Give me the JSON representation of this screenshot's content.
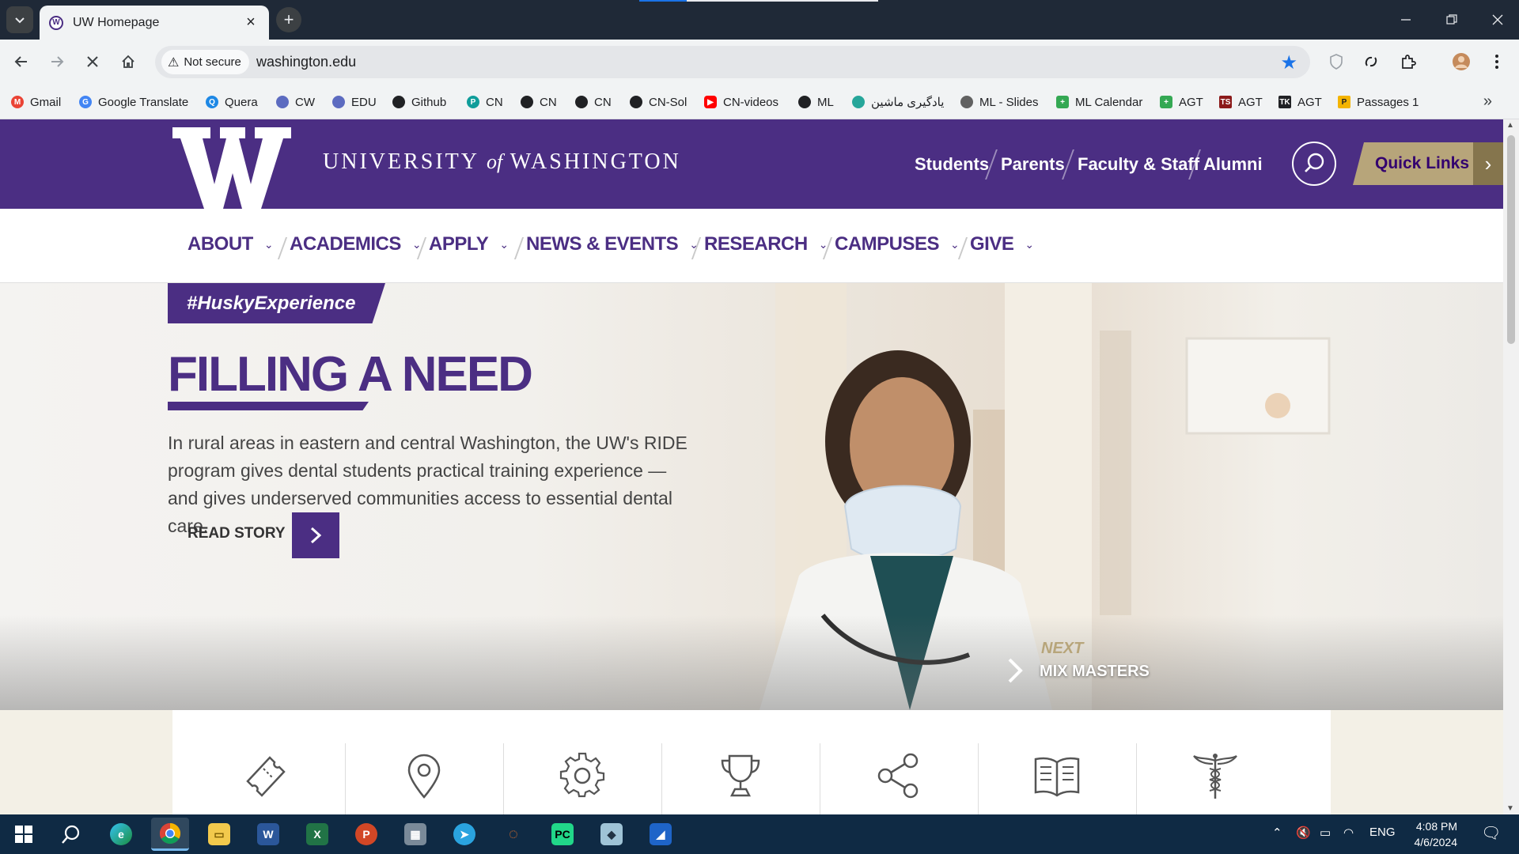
{
  "browser": {
    "tab_title": "UW Homepage",
    "security_label": "Not secure",
    "url": "washington.edu",
    "bookmarks": [
      {
        "label": "Gmail",
        "icon": "gmail-icon",
        "color": "#ea4335"
      },
      {
        "label": "Google Translate",
        "icon": "translate-icon",
        "color": "#4285f4"
      },
      {
        "label": "Quera",
        "icon": "quera-icon",
        "color": "#1e88e5"
      },
      {
        "label": "CW",
        "icon": "globe-icon",
        "color": "#5c6bc0"
      },
      {
        "label": "EDU",
        "icon": "globe-icon",
        "color": "#5c6bc0"
      },
      {
        "label": "Github",
        "icon": "github-icon",
        "color": "#202124"
      },
      {
        "label": "CN",
        "icon": "p-icon",
        "color": "#0f9d9a"
      },
      {
        "label": "CN",
        "icon": "globe-dark-icon",
        "color": "#202124"
      },
      {
        "label": "CN",
        "icon": "globe-dark-icon",
        "color": "#202124"
      },
      {
        "label": "CN-Sol",
        "icon": "github-icon",
        "color": "#202124"
      },
      {
        "label": "CN-videos",
        "icon": "youtube-icon",
        "color": "#ff0000"
      },
      {
        "label": "ML",
        "icon": "globe-dark-icon",
        "color": "#202124"
      },
      {
        "label": "یادگیری ماشین",
        "icon": "ml-icon",
        "color": "#26a69a"
      },
      {
        "label": "ML - Slides",
        "icon": "pen-icon",
        "color": "#616161"
      },
      {
        "label": "ML Calendar",
        "icon": "plus-icon",
        "color": "#34a853"
      },
      {
        "label": "AGT",
        "icon": "plus-icon",
        "color": "#34a853"
      },
      {
        "label": "AGT",
        "icon": "ts-icon",
        "color": "#8b1a1a"
      },
      {
        "label": "AGT",
        "icon": "tk-icon",
        "color": "#202124"
      },
      {
        "label": "Passages 1",
        "icon": "passages-icon",
        "color": "#f4b400"
      }
    ]
  },
  "site": {
    "brand_color": "#4b2e83",
    "gold_color": "#b7a57a",
    "logo_letter": "W",
    "wordmark": {
      "pre": "UNIVERSITY",
      "of": "of",
      "post": "WASHINGTON"
    },
    "audience_links": [
      "Students",
      "Parents",
      "Faculty & Staff",
      "Alumni"
    ],
    "quick_links_label": "Quick Links",
    "nav": [
      "ABOUT",
      "ACADEMICS",
      "APPLY",
      "NEWS & EVENTS",
      "RESEARCH",
      "CAMPUSES",
      "GIVE"
    ],
    "hero": {
      "tag": "#HuskyExperience",
      "headline": "FILLING A NEED",
      "blurb": "In rural areas in eastern and central Washington, the UW's RIDE program gives dental students practical training experience — and gives underserved communities access to essential dental care.",
      "cta_label": "READ STORY",
      "next_label": "NEXT",
      "next_title": "MIX MASTERS"
    },
    "icon_row": [
      "ticket-icon",
      "map-pin-icon",
      "gear-icon",
      "trophy-icon",
      "share-icon",
      "book-icon",
      "caduceus-icon"
    ]
  },
  "taskbar": {
    "language": "ENG",
    "time": "4:08 PM",
    "date": "4/6/2024"
  }
}
